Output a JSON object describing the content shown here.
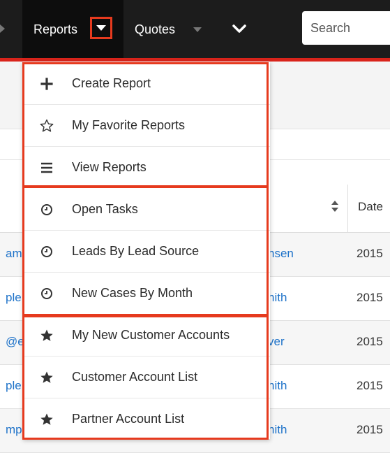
{
  "nav": {
    "reports_label": "Reports",
    "quotes_label": "Quotes",
    "search_placeholder": "Search"
  },
  "table": {
    "column_date_label": "Date",
    "rows": [
      {
        "left": "amp",
        "name": "nsen",
        "year": "2015"
      },
      {
        "left": "ple",
        "name": "nith",
        "year": "2015"
      },
      {
        "left": "@e",
        "name": "ver",
        "year": "2015"
      },
      {
        "left": "ple",
        "name": "nith",
        "year": "2015"
      },
      {
        "left": "mp",
        "name": "nith",
        "year": "2015"
      }
    ]
  },
  "menu": {
    "actions": [
      {
        "icon": "plus-icon",
        "label": "Create Report"
      },
      {
        "icon": "star-outline-icon",
        "label": "My Favorite Reports"
      },
      {
        "icon": "list-icon",
        "label": "View Reports"
      }
    ],
    "recent": [
      {
        "icon": "clock-icon",
        "label": "Open Tasks"
      },
      {
        "icon": "clock-icon",
        "label": "Leads By Lead Source"
      },
      {
        "icon": "clock-icon",
        "label": "New Cases By Month"
      }
    ],
    "favorites": [
      {
        "icon": "star-filled-icon",
        "label": "My New Customer Accounts"
      },
      {
        "icon": "star-filled-icon",
        "label": "Customer Account List"
      },
      {
        "icon": "star-filled-icon",
        "label": "Partner Account List"
      }
    ]
  },
  "colors": {
    "nav_bg": "#1c1c1c",
    "active_tab_bg": "#0d0d0d",
    "brand_red": "#d9241b",
    "highlight_border": "#e63a1e",
    "link_blue": "#1f73c9"
  }
}
